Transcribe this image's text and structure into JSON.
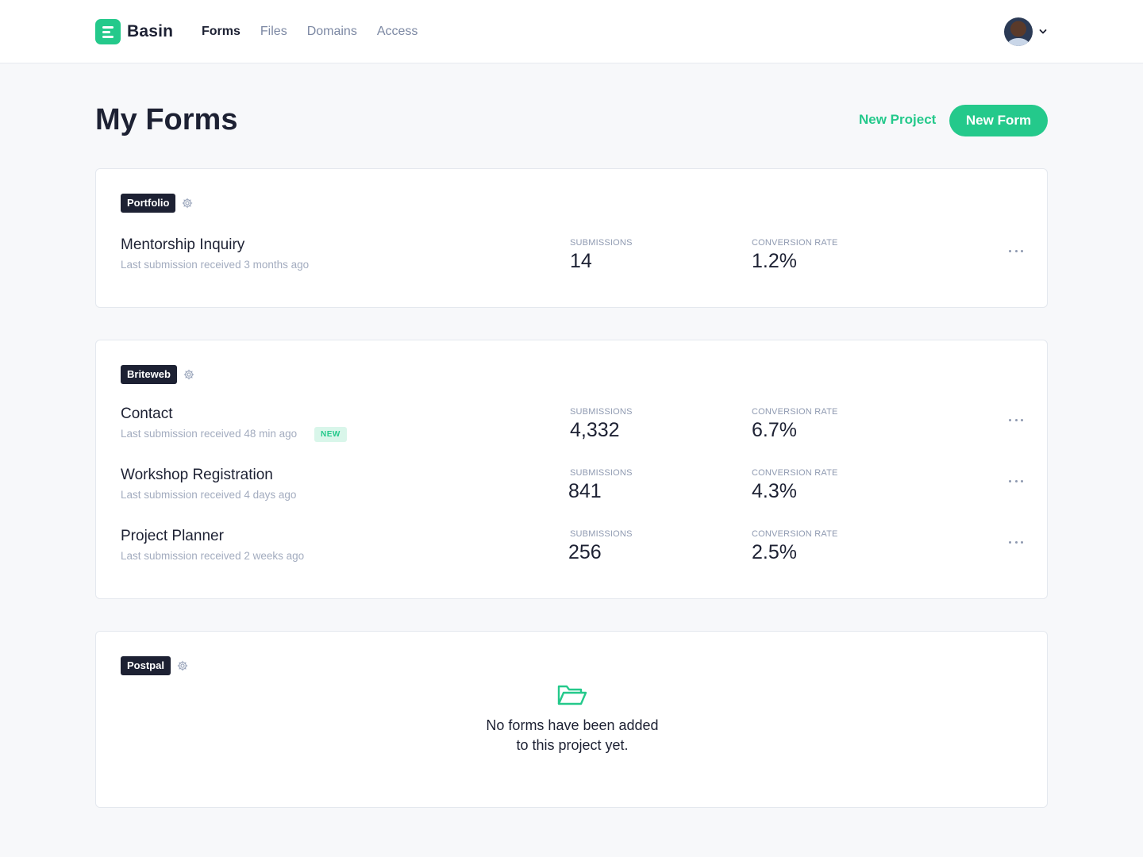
{
  "header": {
    "brand": "Basin",
    "nav": [
      {
        "label": "Forms",
        "active": true
      },
      {
        "label": "Files",
        "active": false
      },
      {
        "label": "Domains",
        "active": false
      },
      {
        "label": "Access",
        "active": false
      }
    ]
  },
  "page": {
    "title": "My Forms",
    "new_project_label": "New Project",
    "new_form_label": "New Form"
  },
  "projects": [
    {
      "name": "Portfolio",
      "forms": [
        {
          "name": "Mentorship Inquiry",
          "last_submission": "Last submission received 3 months ago",
          "is_new": false,
          "submissions_label": "SUBMISSIONS",
          "submissions": "14",
          "conversion_label": "CONVERSION RATE",
          "conversion": "1.2%"
        }
      ]
    },
    {
      "name": "Briteweb",
      "forms": [
        {
          "name": "Contact",
          "last_submission": "Last submission received 48 min ago",
          "is_new": true,
          "new_label": "NEW",
          "submissions_label": "SUBMISSIONS",
          "submissions": "4,332",
          "conversion_label": "CONVERSION RATE",
          "conversion": "6.7%"
        },
        {
          "name": "Workshop Registration",
          "last_submission": "Last submission received 4 days ago",
          "is_new": false,
          "submissions_label": "SUBMISSIONS",
          "submissions": "841",
          "conversion_label": "CONVERSION RATE",
          "conversion": "4.3%"
        },
        {
          "name": "Project Planner",
          "last_submission": "Last submission received 2 weeks ago",
          "is_new": false,
          "submissions_label": "SUBMISSIONS",
          "submissions": "256",
          "conversion_label": "CONVERSION RATE",
          "conversion": "2.5%"
        }
      ]
    },
    {
      "name": "Postpal",
      "forms": [],
      "empty_line1": "No forms have been added",
      "empty_line2": "to this project yet."
    }
  ],
  "icons": {
    "logo": "basin-logo-icon",
    "settings": "gear-icon",
    "more": "more-horizontal-icon",
    "empty": "folder-open-icon",
    "user_menu": "chevron-down-icon"
  },
  "colors": {
    "accent": "#24c98b",
    "dark": "#1d2133",
    "muted": "#a3acbf",
    "background": "#f7f8fa"
  }
}
